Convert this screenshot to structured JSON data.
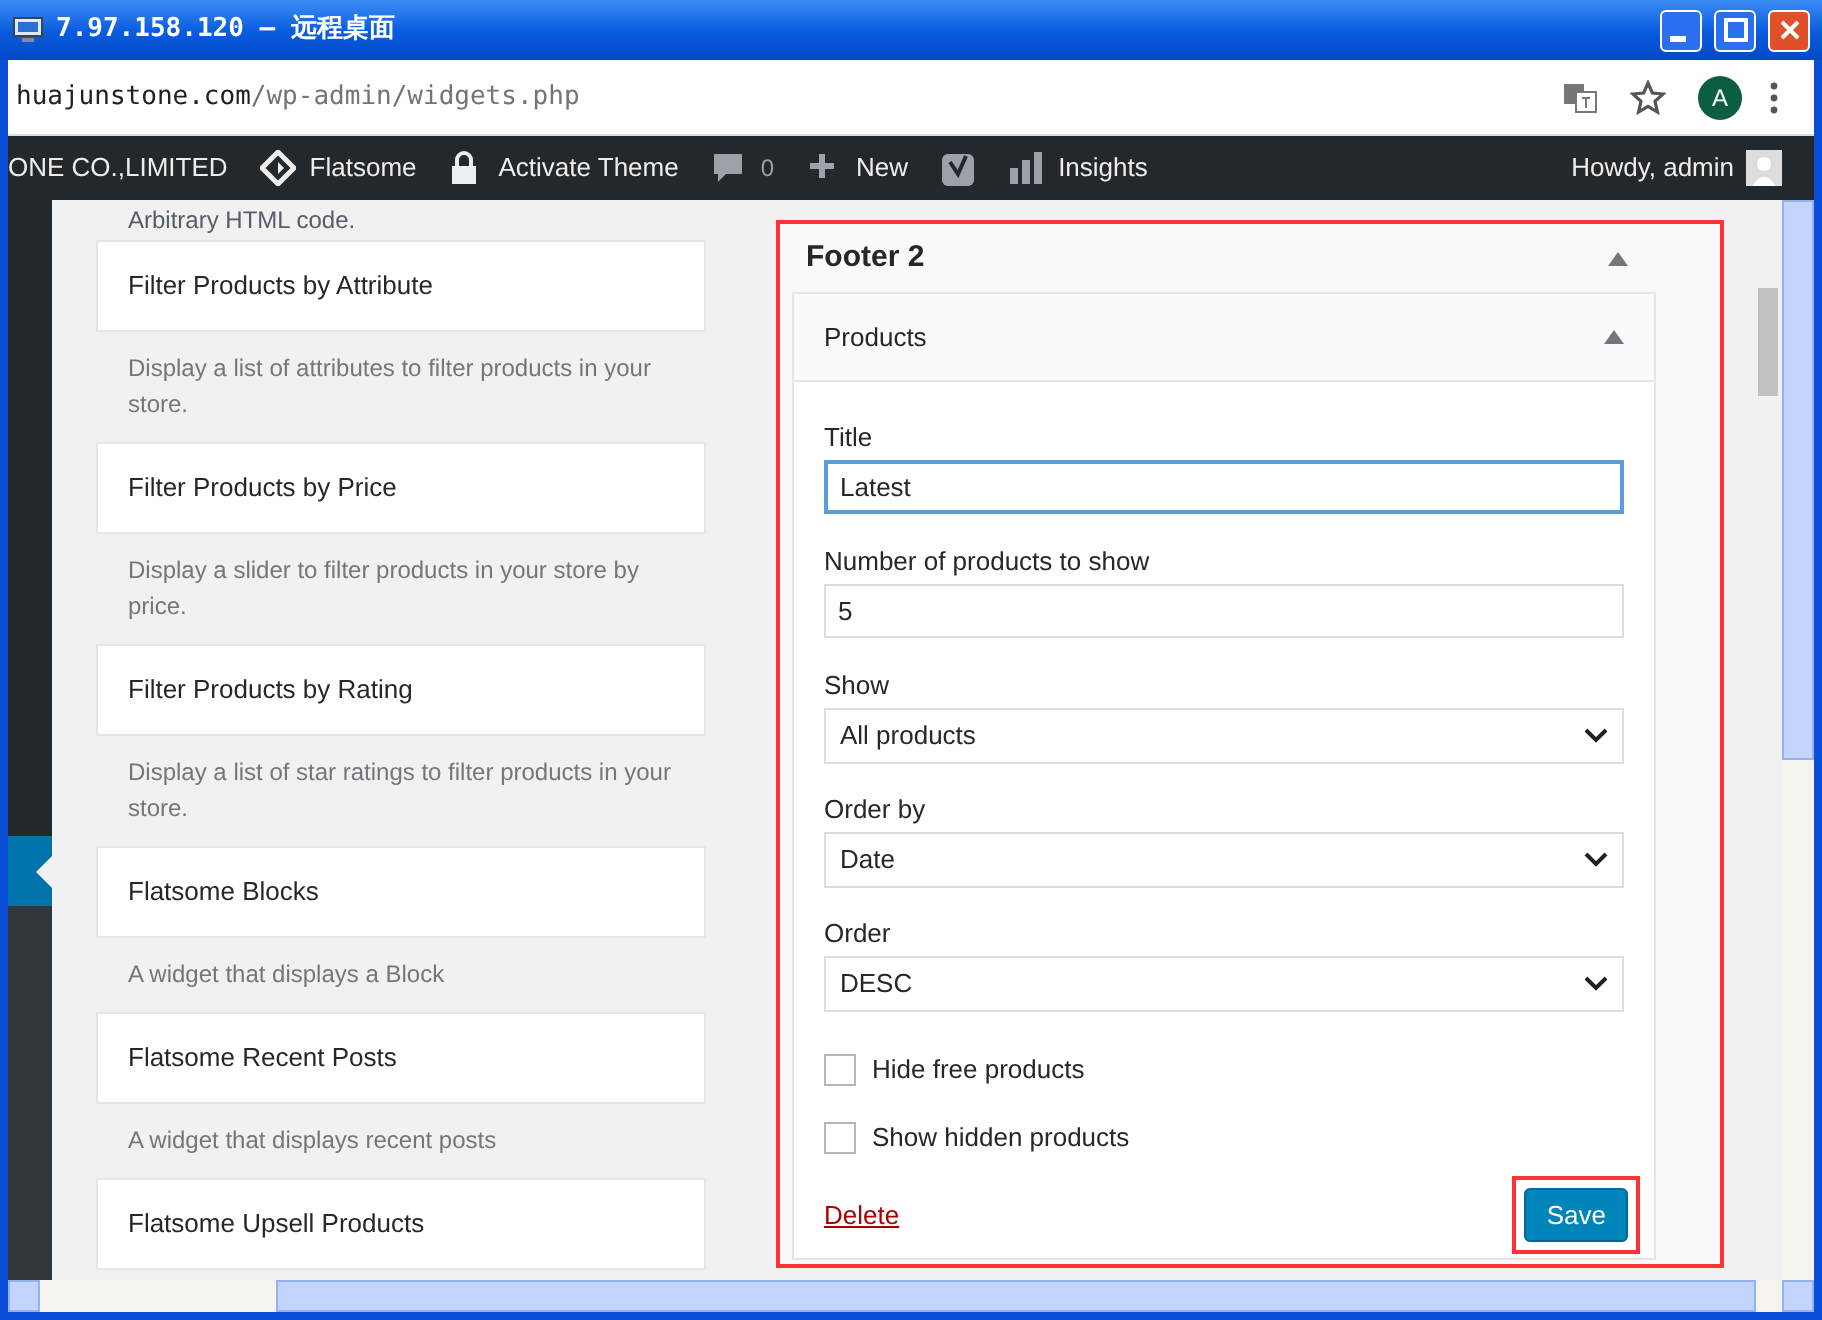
{
  "window": {
    "title": "7.97.158.120 – 远程桌面"
  },
  "browser": {
    "url_host": "huajunstone.com",
    "url_path": "/wp-admin/widgets.php",
    "profile_letter": "A"
  },
  "admin_bar": {
    "items": [
      {
        "kind": "site",
        "label": "ONE CO.,LIMITED"
      },
      {
        "kind": "flatsome",
        "label": "Flatsome"
      },
      {
        "kind": "lock",
        "label": "Activate Theme"
      },
      {
        "kind": "comments",
        "label": "0"
      },
      {
        "kind": "new",
        "label": "New"
      },
      {
        "kind": "yoast"
      },
      {
        "kind": "insights",
        "label": "Insights"
      }
    ],
    "greeting": "Howdy, admin"
  },
  "available_widgets": {
    "cut_description": "Arbitrary HTML code.",
    "widgets": [
      {
        "name": "Filter Products by Attribute",
        "description": "Display a list of attributes to filter products in your store."
      },
      {
        "name": "Filter Products by Price",
        "description": "Display a slider to filter products in your store by price."
      },
      {
        "name": "Filter Products by Rating",
        "description": "Display a list of star ratings to filter products in your store."
      },
      {
        "name": "Flatsome Blocks",
        "description": "A widget that displays a Block"
      },
      {
        "name": "Flatsome Recent Posts",
        "description": "A widget that displays recent posts"
      },
      {
        "name": "Flatsome Upsell Products"
      }
    ]
  },
  "sidebar": {
    "title": "Footer 2",
    "highlighted": true,
    "widget": {
      "title": "Products",
      "fields": [
        {
          "kind": "text",
          "label": "Title",
          "value": "Latest",
          "focused": true
        },
        {
          "kind": "text",
          "label": "Number of products to show",
          "value": "5",
          "focused": false
        },
        {
          "kind": "select",
          "label": "Show",
          "value": "All products"
        },
        {
          "kind": "select",
          "label": "Order by",
          "value": "Date"
        },
        {
          "kind": "select",
          "label": "Order",
          "value": "DESC"
        },
        {
          "kind": "checkbox",
          "label": "Hide free products",
          "checked": false
        },
        {
          "kind": "checkbox",
          "label": "Show hidden products",
          "checked": false
        }
      ],
      "delete_label": "Delete",
      "save_label": "Save",
      "save_highlighted": true
    }
  }
}
